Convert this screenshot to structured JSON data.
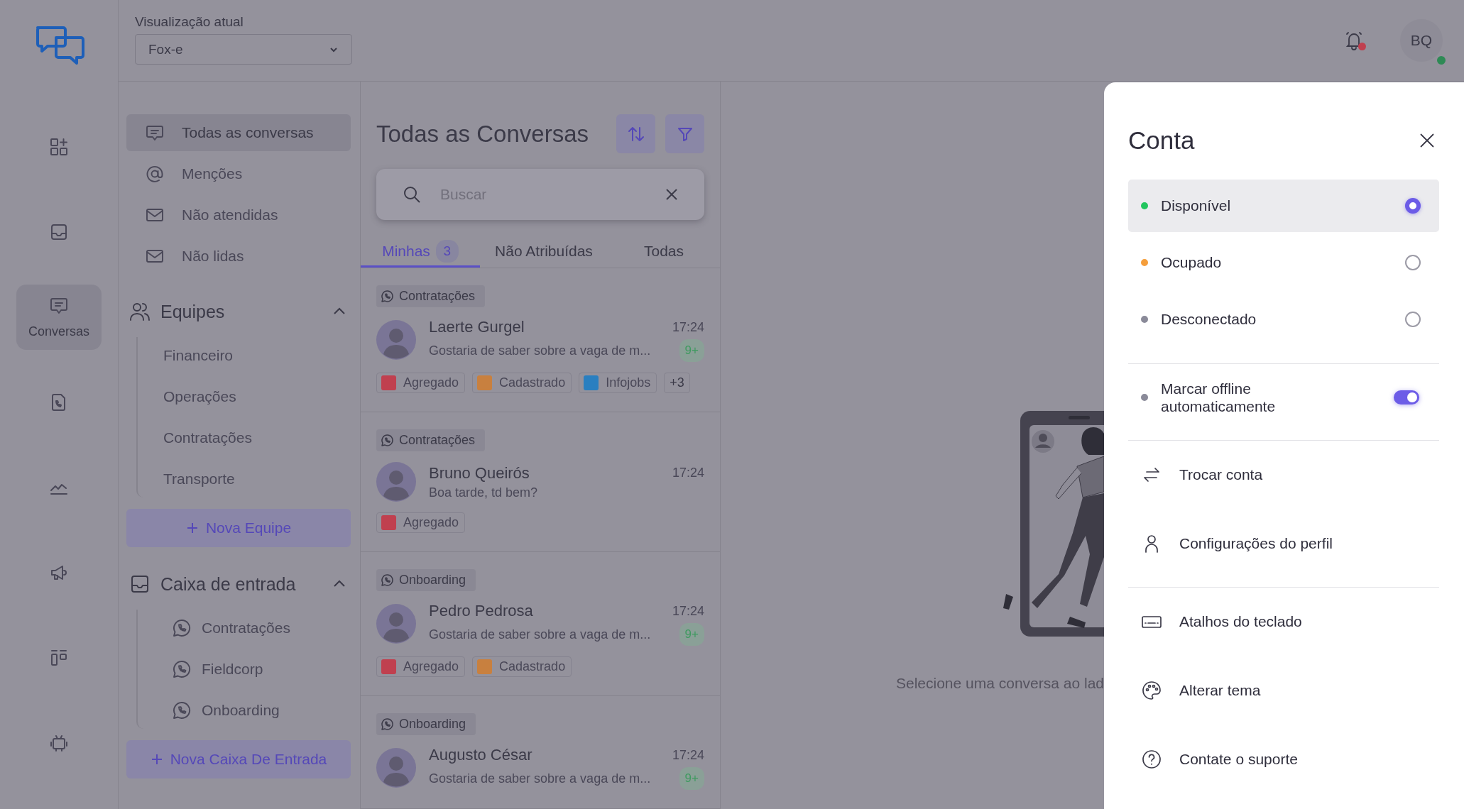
{
  "rail": {
    "items": [
      {
        "kind": "dashboard",
        "selected": false
      },
      {
        "kind": "inbox",
        "selected": false
      },
      {
        "kind": "chat",
        "label": "Conversas",
        "selected": true
      },
      {
        "kind": "call-log",
        "selected": false
      },
      {
        "kind": "chart",
        "selected": false
      },
      {
        "kind": "megaphone",
        "selected": false
      },
      {
        "kind": "board",
        "selected": false
      },
      {
        "kind": "robot",
        "selected": false
      }
    ]
  },
  "view_selector": {
    "label": "Visualização atual",
    "value": "Fox-e"
  },
  "header": {
    "notifications": {
      "unread": true
    },
    "user": {
      "initials": "BQ",
      "online": true
    }
  },
  "nav": {
    "items": [
      {
        "kind": "chat",
        "label": "Todas as conversas",
        "selected": true
      },
      {
        "kind": "mention",
        "label": "Menções",
        "selected": false
      },
      {
        "kind": "mail",
        "label": "Não atendidas",
        "selected": false
      },
      {
        "kind": "mail",
        "label": "Não lidas",
        "selected": false
      }
    ],
    "sections": [
      {
        "kind": "teams",
        "title": "Equipes",
        "expanded": true,
        "items": [
          "Financeiro",
          "Operações",
          "Contratações",
          "Transporte"
        ],
        "add_button": "Nova Equipe"
      },
      {
        "kind": "inboxes",
        "title": "Caixa de entrada",
        "expanded": true,
        "items": [
          "Contratações",
          "Fieldcorp",
          "Onboarding"
        ],
        "add_button": "Nova Caixa De Entrada"
      }
    ]
  },
  "conversations": {
    "title": "Todas as Conversas",
    "search": {
      "placeholder": "Buscar"
    },
    "tabs": [
      {
        "label": "Minhas",
        "count": "3",
        "selected": true
      },
      {
        "label": "Não Atribuídas",
        "selected": false
      },
      {
        "label": "Todas",
        "selected": false
      }
    ],
    "items": [
      {
        "channel": "Contratações",
        "name": "Laerte Gurgel",
        "time": "17:24",
        "preview": "Gostaria de saber sobre a vaga de m...",
        "unread": "9+",
        "labels": [
          {
            "name": "Agregado",
            "color": "#c0404f"
          },
          {
            "name": "Cadastrado",
            "color": "#c8803f"
          },
          {
            "name": "Infojobs",
            "color": "#2a7fc0"
          }
        ],
        "more": "+3"
      },
      {
        "channel": "Contratações",
        "name": "Bruno Queirós",
        "time": "17:24",
        "preview": "Boa tarde, td bem?",
        "labels": [
          {
            "name": "Agregado",
            "color": "#c0404f"
          }
        ]
      },
      {
        "channel": "Onboarding",
        "name": "Pedro Pedrosa",
        "time": "17:24",
        "preview": "Gostaria de saber sobre a vaga de m...",
        "unread": "9+",
        "labels": [
          {
            "name": "Agregado",
            "color": "#c0404f"
          },
          {
            "name": "Cadastrado",
            "color": "#c8803f"
          }
        ]
      },
      {
        "channel": "Onboarding",
        "name": "Augusto César",
        "time": "17:24",
        "preview": "Gostaria de saber sobre a vaga de m...",
        "unread": "9+"
      }
    ]
  },
  "empty_state": {
    "message": "Selecione uma conversa ao lad"
  },
  "account_panel": {
    "title": "Conta",
    "statuses": [
      {
        "label": "Disponível",
        "color": "#22c55e",
        "selected": true
      },
      {
        "label": "Ocupado",
        "color": "#f59e3b",
        "selected": false
      },
      {
        "label": "Desconectado",
        "color": "#8a8a99",
        "selected": false
      }
    ],
    "auto_offline": {
      "label": "Marcar offline automaticamente",
      "color": "#8a8a99",
      "on": true
    },
    "menu_groups": [
      [
        {
          "kind": "switch",
          "label": "Trocar conta"
        },
        {
          "kind": "profile",
          "label": "Configurações do perfil"
        }
      ],
      [
        {
          "kind": "keyboard",
          "label": "Atalhos do teclado"
        },
        {
          "kind": "theme",
          "label": "Alterar tema"
        },
        {
          "kind": "support",
          "label": "Contate o suporte"
        }
      ]
    ]
  }
}
